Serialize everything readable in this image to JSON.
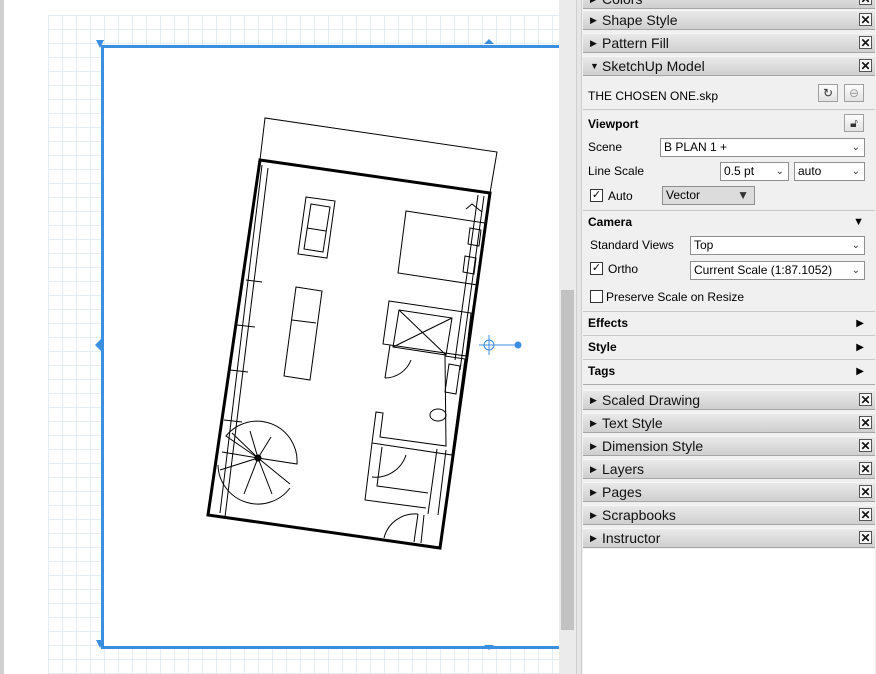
{
  "canvas": {
    "accent": "#3b8fe0"
  },
  "trays_top": [
    {
      "label": "Colors",
      "icon": "collapsed-triangle-icon"
    },
    {
      "label": "Shape Style",
      "icon": "collapsed-triangle-icon"
    },
    {
      "label": "Pattern Fill",
      "icon": "collapsed-triangle-icon"
    }
  ],
  "sketchup_tray": {
    "label": "SketchUp Model",
    "file_name": "THE CHOSEN ONE.skp",
    "viewport": {
      "heading": "Viewport",
      "scene_label": "Scene",
      "scene_value": "B PLAN 1 +",
      "line_scale_label": "Line Scale",
      "line_scale_value": "0.5 pt",
      "line_scale_mode": "auto",
      "auto_label": "Auto",
      "auto_checked": true,
      "render_mode": "Vector"
    },
    "camera": {
      "heading": "Camera",
      "standard_views_label": "Standard Views",
      "standard_views_value": "Top",
      "ortho_label": "Ortho",
      "ortho_checked": true,
      "scale_value": "Current Scale (1:87.1052)",
      "preserve_label": "Preserve Scale on Resize",
      "preserve_checked": false
    },
    "sections": [
      "Effects",
      "Style",
      "Tags"
    ]
  },
  "trays_bottom": [
    {
      "label": "Scaled Drawing"
    },
    {
      "label": "Text Style"
    },
    {
      "label": "Dimension Style"
    },
    {
      "label": "Layers"
    },
    {
      "label": "Pages"
    },
    {
      "label": "Scrapbooks"
    },
    {
      "label": "Instructor"
    }
  ],
  "glyphs": {
    "close": "✕",
    "collapsed": "▶",
    "expanded": "▼",
    "check": "✓",
    "caret": "▼"
  }
}
